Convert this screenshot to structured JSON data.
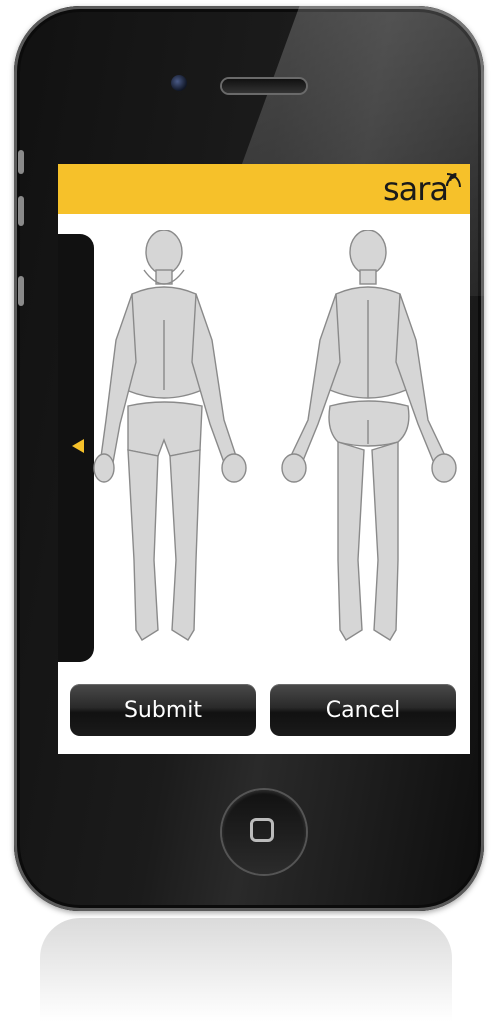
{
  "app": {
    "brand": "sara",
    "colors": {
      "header": "#f6c12a",
      "accent": "#f6c12a",
      "button": "#2a2a2a",
      "phone": "#111111"
    }
  },
  "drawer": {
    "icon": "triangle-left-icon"
  },
  "body_map": {
    "views": [
      "front",
      "back"
    ]
  },
  "actions": {
    "submit_label": "Submit",
    "cancel_label": "Cancel"
  },
  "device": {
    "home_icon": "home-square-icon"
  }
}
